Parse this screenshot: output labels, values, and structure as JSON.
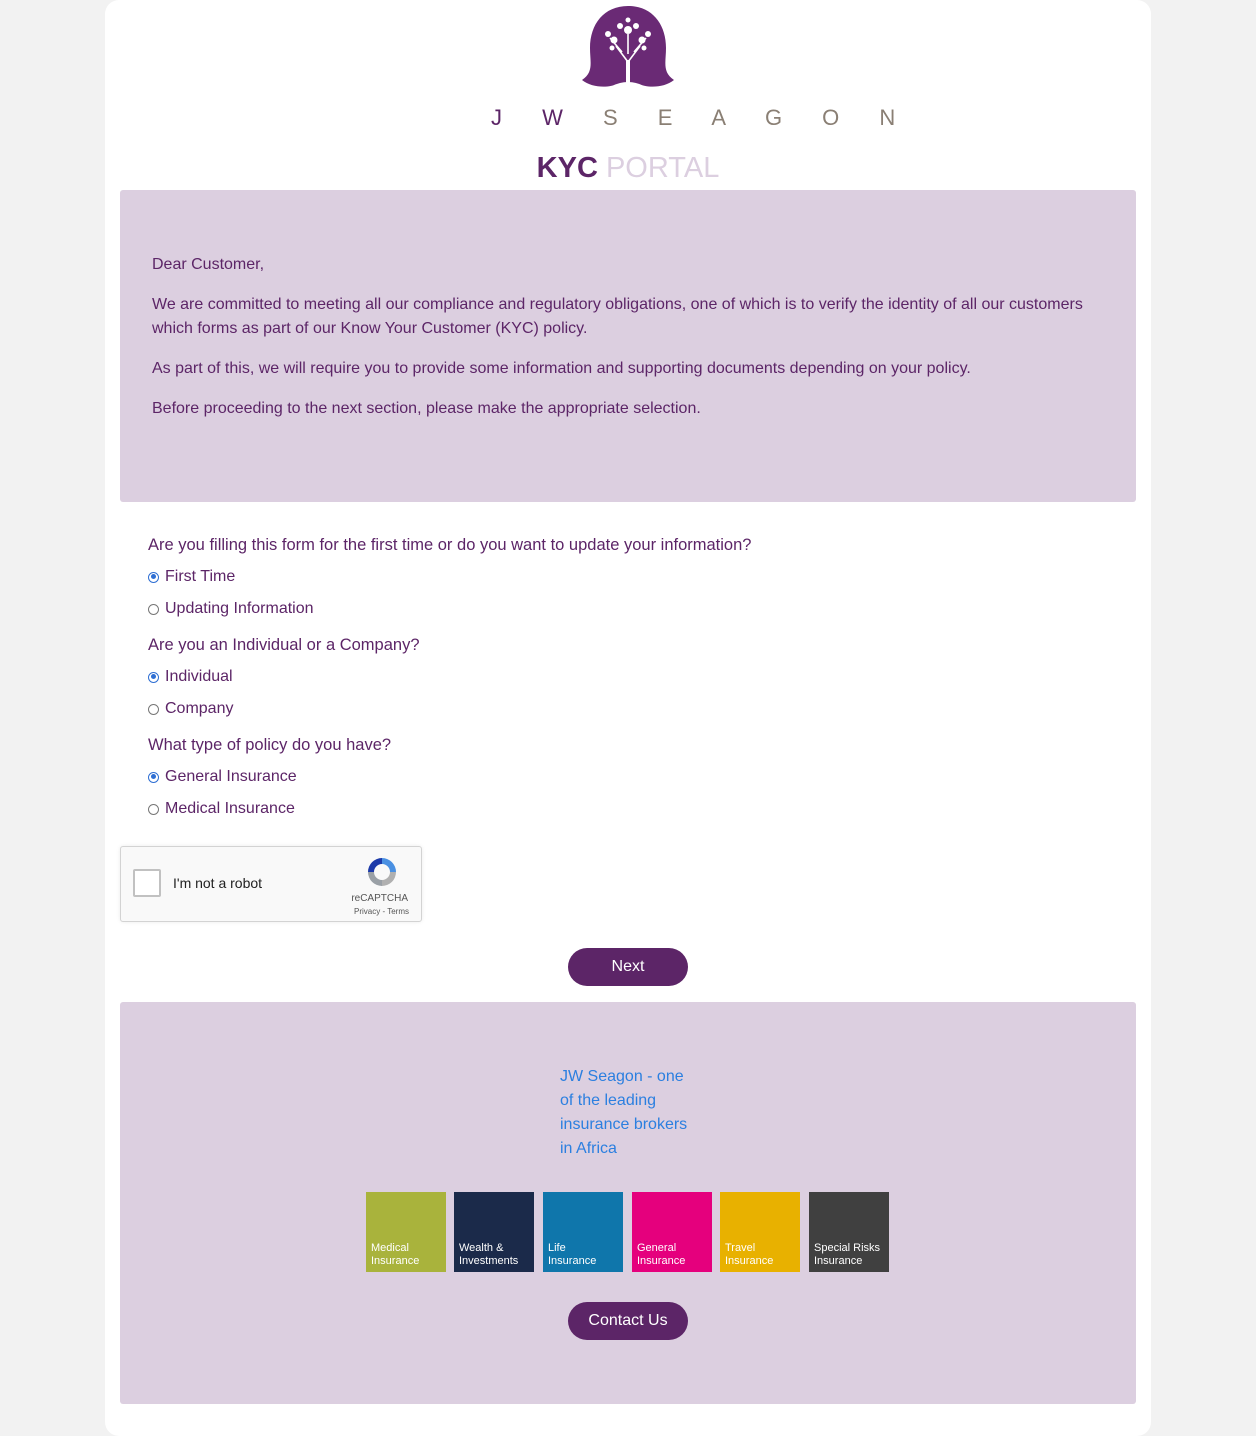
{
  "brand": {
    "wordmark_left": "J W",
    "wordmark_right": "S E A G O N",
    "title_strong": "KYC",
    "title_light": "PORTAL",
    "primary_color": "#5c2567",
    "secondary_color": "#dccfe0"
  },
  "intro": {
    "paragraphs": [
      "Dear Customer,",
      "We are committed to meeting all our compliance and regulatory obligations, one of which is to verify the identity of all our customers which forms as part of our Know Your Customer (KYC) policy.",
      "As part of this, we will require you to provide some information and supporting documents depending on your policy.",
      "Before proceeding to the next section, please make the appropriate selection."
    ]
  },
  "questions": [
    {
      "label": "Are you filling this form for the first time or do you want to update your information?",
      "options": [
        {
          "label": "First Time",
          "selected": true
        },
        {
          "label": "Updating Information",
          "selected": false
        }
      ]
    },
    {
      "label": "Are you an Individual or a Company?",
      "options": [
        {
          "label": "Individual",
          "selected": true
        },
        {
          "label": "Company",
          "selected": false
        }
      ]
    },
    {
      "label": "What type of policy do you have?",
      "options": [
        {
          "label": "General Insurance",
          "selected": true
        },
        {
          "label": "Medical Insurance",
          "selected": false
        }
      ]
    }
  ],
  "captcha": {
    "label": "I'm not a robot",
    "brand": "reCAPTCHA",
    "links": "Privacy - Terms",
    "checked": false
  },
  "next_button": "Next",
  "footer": {
    "tagline": "JW Seagon - one of the leading insurance brokers in Africa",
    "tiles": [
      {
        "line1": "Medical",
        "line2": "Insurance",
        "color": "#a9b33c"
      },
      {
        "line1": "Wealth &",
        "line2": "Investments",
        "color": "#1b2a4a"
      },
      {
        "line1": "Life",
        "line2": "Insurance",
        "color": "#0f76ab"
      },
      {
        "line1": "General",
        "line2": "Insurance",
        "color": "#e5007d"
      },
      {
        "line1": "Travel",
        "line2": "Insurance",
        "color": "#e8b100"
      },
      {
        "line1": "Special Risks",
        "line2": "Insurance",
        "color": "#404040"
      }
    ],
    "contact_button": "Contact Us"
  }
}
